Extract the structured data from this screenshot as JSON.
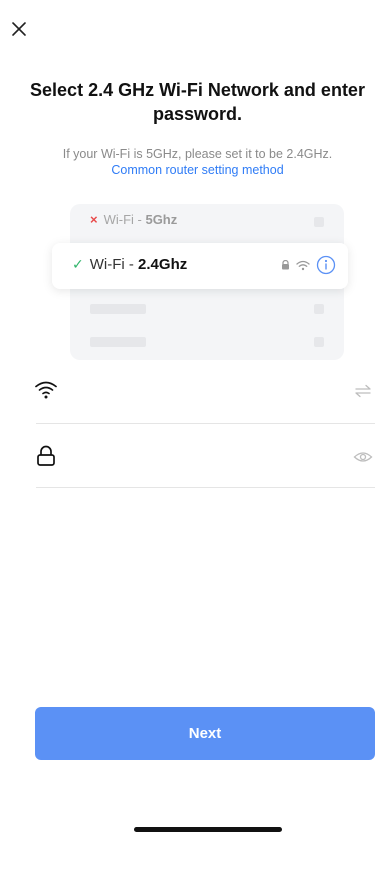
{
  "header": {
    "close_icon": "close-icon",
    "title": "Select 2.4 GHz Wi-Fi Network and enter password.",
    "subtitle": "If your Wi-Fi is 5GHz, please set it to be 2.4GHz.",
    "router_link": "Common router setting method"
  },
  "illustration": {
    "bad_network": {
      "mark": "×",
      "prefix": "Wi-Fi - ",
      "band": "5Ghz"
    },
    "good_network": {
      "mark": "✓",
      "prefix": "Wi-Fi - ",
      "band": "2.4Ghz",
      "icons": [
        "lock-icon",
        "wifi-icon",
        "info-icon"
      ]
    }
  },
  "form": {
    "wifi_field": {
      "icon": "wifi-icon",
      "value": "",
      "action_icon": "switch-network-icon"
    },
    "password_field": {
      "icon": "lock-icon",
      "value": "",
      "action_icon": "eye-icon"
    }
  },
  "actions": {
    "next_label": "Next"
  },
  "colors": {
    "accent": "#5b91f5",
    "link": "#2f7cf6",
    "error": "#e84a4a",
    "success": "#31b56b"
  }
}
